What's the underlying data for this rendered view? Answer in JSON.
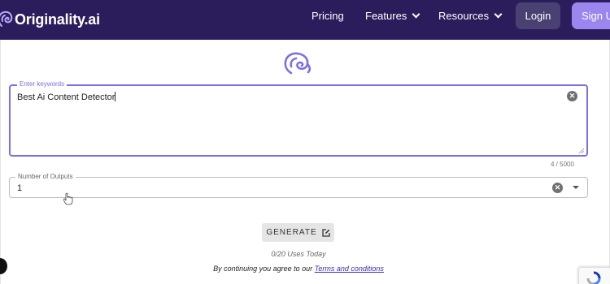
{
  "navbar": {
    "brand": "Originality.ai",
    "links": [
      {
        "label": "Pricing"
      },
      {
        "label": "Features"
      },
      {
        "label": "Resources"
      }
    ],
    "login_label": "Login",
    "signup_label": "Sign Up"
  },
  "form": {
    "keywords": {
      "label": "Enter keywords",
      "value": "Best Ai Content Detector",
      "char_count": "4 / 5000"
    },
    "outputs": {
      "label": "Number of Outputs",
      "value": "1"
    },
    "generate_label": "GENERATE",
    "uses_text": "0/20 Uses Today",
    "terms_prefix": "By continuing you agree to our",
    "terms_link": "Terms and conditions"
  },
  "icons": {
    "brand_logo": "brain-icon",
    "center_logo": "brain-icon",
    "clear": "clear-circle-icon",
    "dropdown": "caret-down-icon",
    "generate": "edit-icon",
    "cursor": "hand-cursor-icon",
    "recaptcha": "recaptcha-icon"
  },
  "colors": {
    "navbar_bg": "#2b1d5c",
    "accent": "#7d6ee6",
    "signup_bg": "#9b86f0",
    "login_bg": "#4a4173",
    "link": "#3d2bb5"
  }
}
